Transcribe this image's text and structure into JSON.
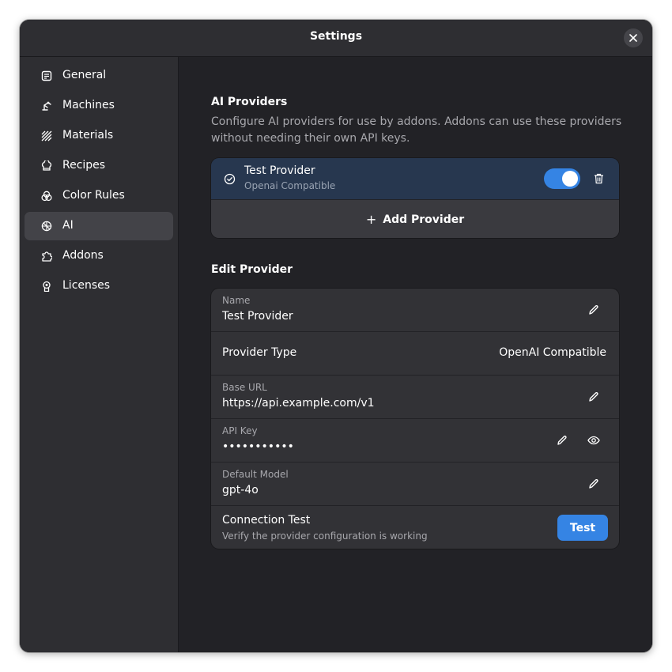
{
  "window": {
    "title": "Settings"
  },
  "sidebar": {
    "items": [
      {
        "label": "General",
        "icon": "general-icon"
      },
      {
        "label": "Machines",
        "icon": "machine-icon"
      },
      {
        "label": "Materials",
        "icon": "materials-icon"
      },
      {
        "label": "Recipes",
        "icon": "recipes-icon"
      },
      {
        "label": "Color Rules",
        "icon": "color-rules-icon"
      },
      {
        "label": "AI",
        "icon": "ai-icon",
        "selected": true
      },
      {
        "label": "Addons",
        "icon": "puzzle-icon"
      },
      {
        "label": "Licenses",
        "icon": "license-icon"
      }
    ]
  },
  "ai_providers": {
    "title": "AI Providers",
    "description": "Configure AI providers for use by addons. Addons can use these providers without needing their own API keys.",
    "provider": {
      "name": "Test Provider",
      "type": "Openai Compatible",
      "enabled": true
    },
    "add_label": "Add Provider"
  },
  "edit_provider": {
    "title": "Edit Provider",
    "name": {
      "label": "Name",
      "value": "Test Provider"
    },
    "provider_type": {
      "label": "Provider Type",
      "value": "OpenAI Compatible"
    },
    "base_url": {
      "label": "Base URL",
      "value": "https://api.example.com/v1"
    },
    "api_key": {
      "label": "API Key",
      "value": "•••••••••••"
    },
    "default_model": {
      "label": "Default Model",
      "value": "gpt-4o"
    },
    "connection_test": {
      "label": "Connection Test",
      "description": "Verify the provider configuration is working",
      "button": "Test"
    }
  },
  "colors": {
    "accent": "#3584e4",
    "selected_provider_bg": "#27374f",
    "window_bg": "#222226",
    "sidebar_bg": "#2e2e32"
  }
}
